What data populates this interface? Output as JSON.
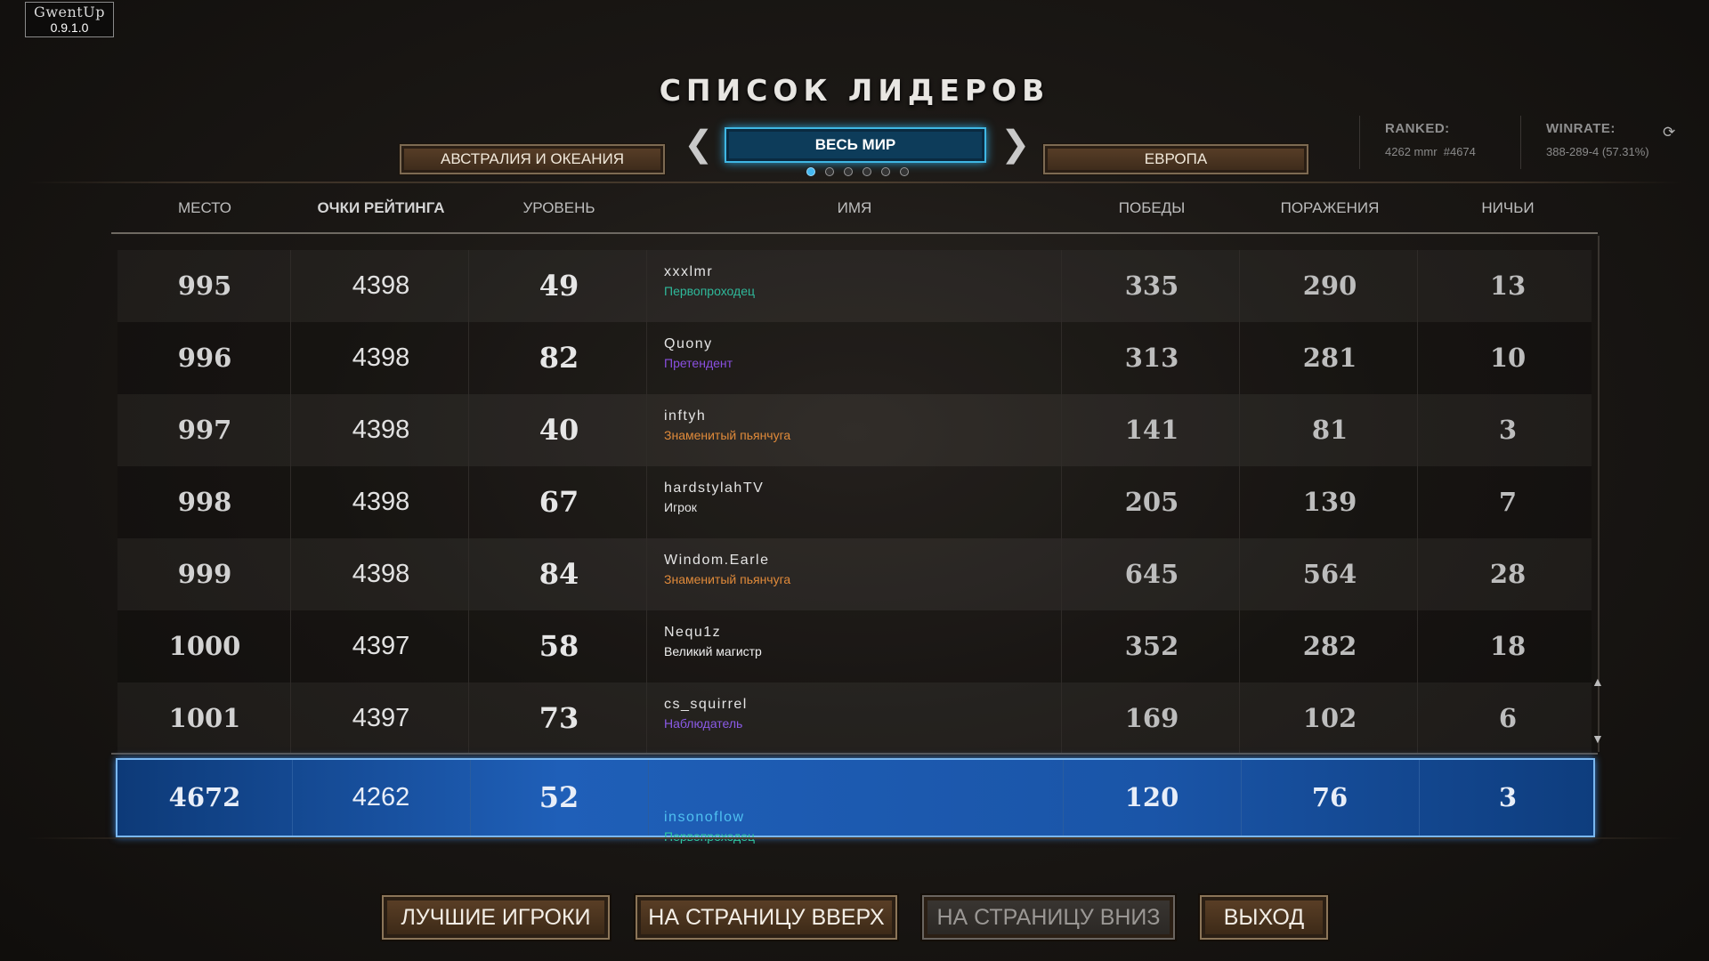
{
  "app_badge": {
    "name": "GwentUp",
    "version": "0.9.1.0"
  },
  "title": "СПИСОК ЛИДЕРОВ",
  "regions": {
    "left": "АВСТРАЛИЯ И ОКЕАНИЯ",
    "current": "ВЕСЬ МИР",
    "right": "ЕВРОПА",
    "pages": 6,
    "active_page": 1
  },
  "stats": {
    "ranked_label": "RANKED:",
    "ranked_value": "4262 mmr  #4674",
    "winrate_label": "WINRATE:",
    "winrate_value": "388-289-4 (57.31%)"
  },
  "columns": {
    "rank": "МЕСТО",
    "mmr": "ОЧКИ РЕЙТИНГА",
    "level": "УРОВЕНЬ",
    "name": "ИМЯ",
    "wins": "ПОБЕДЫ",
    "losses": "ПОРАЖЕНИЯ",
    "draws": "НИЧЬИ"
  },
  "rows": [
    {
      "rank": "995",
      "mmr": "4398",
      "level": "49",
      "name": "xxxlmr",
      "title": "Первопроходец",
      "title_color": "#2fb89a",
      "wins": "335",
      "losses": "290",
      "draws": "13"
    },
    {
      "rank": "996",
      "mmr": "4398",
      "level": "82",
      "name": "Quony",
      "title": "Претендент",
      "title_color": "#8a4fe0",
      "wins": "313",
      "losses": "281",
      "draws": "10"
    },
    {
      "rank": "997",
      "mmr": "4398",
      "level": "40",
      "name": "inftyh",
      "title": "Знаменитый пьянчуга",
      "title_color": "#e08a3a",
      "wins": "141",
      "losses": "81",
      "draws": "3"
    },
    {
      "rank": "998",
      "mmr": "4398",
      "level": "67",
      "name": "hardstylahTV",
      "title": "Игрок",
      "title_color": "#e4e4e4",
      "wins": "205",
      "losses": "139",
      "draws": "7"
    },
    {
      "rank": "999",
      "mmr": "4398",
      "level": "84",
      "name": "Windom.Earle",
      "title": "Знаменитый пьянчуга",
      "title_color": "#e08a3a",
      "wins": "645",
      "losses": "564",
      "draws": "28"
    },
    {
      "rank": "1000",
      "mmr": "4397",
      "level": "58",
      "name": "Nequ1z",
      "title": "Великий магистр",
      "title_color": "#f0f0f0",
      "wins": "352",
      "losses": "282",
      "draws": "18"
    },
    {
      "rank": "1001",
      "mmr": "4397",
      "level": "73",
      "name": "cs_squirrel",
      "title": "Наблюдатель",
      "title_color": "#8a5ae6",
      "wins": "169",
      "losses": "102",
      "draws": "6"
    }
  ],
  "me": {
    "rank": "4672",
    "mmr": "4262",
    "level": "52",
    "name": "insonoflow",
    "title": "Первопроходец",
    "name_color": "#4fc0f0",
    "title_color": "#2fc8a0",
    "wins": "120",
    "losses": "76",
    "draws": "3"
  },
  "buttons": {
    "top": "ЛУЧШИЕ ИГРОКИ",
    "page_up": "НА СТРАНИЦУ ВВЕРХ",
    "page_down": "НА СТРАНИЦУ ВНИЗ",
    "exit": "ВЫХОД"
  }
}
